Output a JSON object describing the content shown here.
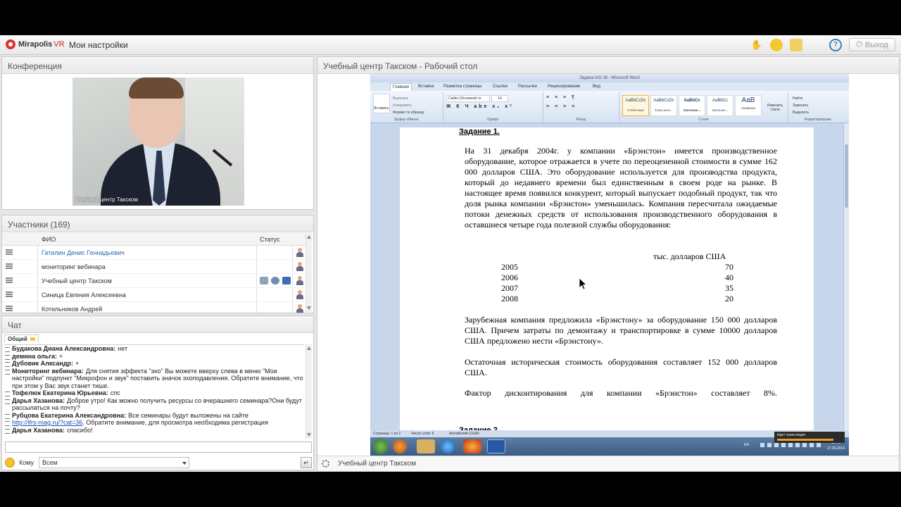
{
  "app": {
    "logo_brand": "Mirapolis",
    "logo_suffix": "VR",
    "my_settings": "Мои настройки",
    "exit_label": "Выход",
    "help_label": "?"
  },
  "conference": {
    "title": "Конференция",
    "video_label": "Учебный центр Такском"
  },
  "participants": {
    "title": "Участники (169)",
    "col_name": "ФИО",
    "col_status": "Статус",
    "rows": [
      {
        "name": "Гатилин Денис  Геннадьевич"
      },
      {
        "name": "мониторинг вебинара"
      },
      {
        "name": "Учебный центр Такском"
      },
      {
        "name": "Синица Евгения  Алексеевна"
      },
      {
        "name": "Котельников Андрей"
      }
    ]
  },
  "chat": {
    "title": "Чат",
    "tab_label": "Общий",
    "messages": [
      {
        "author": "Будакова Диана  Александровна:",
        "text": "нет"
      },
      {
        "author": "демина ольга:",
        "text": "+"
      },
      {
        "author": "Дубовик Алксандр:",
        "text": "+"
      },
      {
        "author": "Мониторинг вебинара:",
        "text": "Для снятия эффекта \"эхо\" Вы можете вверху слева в меню \"Мои настройки\" подпункт \"Микрофон и звук\" поставить значок эхоподавления. Обратите внимание, что при этом у Вас звук станет тише."
      },
      {
        "author": "Тофелюк Екатерина Юрьевна:",
        "text": "спс"
      },
      {
        "author": "Дарья Хазанова:",
        "text": "Доброе утро! Как можно получить ресурсы со вчерашнего семинара?Они будут рассылаться на почту?"
      },
      {
        "author": "Рубцова Екатерина  Александровна:",
        "text": "Все семинары будут выложены на сайте"
      },
      {
        "author": "",
        "link": "http://ifrs-mag.ru/?cat=36",
        "text": ". Обратите внимание, для просмотра необходима регистрация"
      },
      {
        "author": "Дарья Хазанова:",
        "text": "спасибо!"
      }
    ],
    "to_label": "Кому",
    "to_value": "Всем"
  },
  "desktop": {
    "title": "Учебный центр Такском - Рабочий стол",
    "footer_label": "Учебный центр Такском"
  },
  "word": {
    "window_title": "Задача IAS 36 - Microsoft Word",
    "tabs": [
      "Главная",
      "Вставка",
      "Разметка страницы",
      "Ссылки",
      "Рассылки",
      "Рецензирование",
      "Вид"
    ],
    "ribbon_groups": [
      "Буфер обмена",
      "Шрифт",
      "Абзац",
      "Стили",
      "Редактирование"
    ],
    "paste_label": "Вставить",
    "clipboard_items": [
      "Вырезать",
      "Копировать",
      "Формат по образцу"
    ],
    "font_name": "Calibri (Основной те",
    "font_size": "14",
    "styles": [
      {
        "sample": "AaBbCcDc",
        "name": "¶ Обычный"
      },
      {
        "sample": "AaBbCcDc",
        "name": "¶ Без инте..."
      },
      {
        "sample": "AaBbCc",
        "name": "Заголово..."
      },
      {
        "sample": "AaBbCc",
        "name": "Заголово..."
      },
      {
        "sample": "AaB",
        "name": "Название"
      }
    ],
    "change_styles": "Изменить стили",
    "edit_items": [
      "Найти",
      "Заменить",
      "Выделить"
    ],
    "status_items": [
      "Страница: 1 из 2",
      "Число слов: 6",
      "Английский (США)"
    ],
    "clock_time": "11:40",
    "clock_date": "17.06.2014",
    "lang": "EN",
    "notify": "Идет трансляция"
  },
  "document": {
    "heading1": "Задание 1.",
    "para1": "На 31 декабря 2004г. у компании «Брэнстон» имеется производственное оборудование, которое отражается в учете по переоцененной стоимости в сумме 162 000 долларов США. Это оборудование используется для производства продукта, который до недавнего времени был единственным в своем роде на рынке. В настоящее время появился конкурент, который выпускает подобный продукт, так что доля рынка компании «Брэнстон» уменьшилась. Компания пересчитала ожидаемые потоки денежных средств от использования производственного оборудования в оставшиеся четыре года полезной службы оборудования:",
    "table_header": "тыс. долларов США",
    "table_rows": [
      {
        "year": "2005",
        "value": "70"
      },
      {
        "year": "2006",
        "value": "40"
      },
      {
        "year": "2007",
        "value": "35"
      },
      {
        "year": "2008",
        "value": "20"
      }
    ],
    "para2": "Зарубежная компания предложила «Брэнстону» за оборудование 150 000 долларов США. Причем затраты по демонтажу и транспортировке в сумме 10000 долларов США предложено нести «Брэнстону».",
    "para3": "Остаточная историческая стоимость оборудования составляет 152 000 долларов США.",
    "para4": "Фактор дисконтирования для компании «Брэнстон» составляет 8%.",
    "heading2": "Задание 2"
  }
}
